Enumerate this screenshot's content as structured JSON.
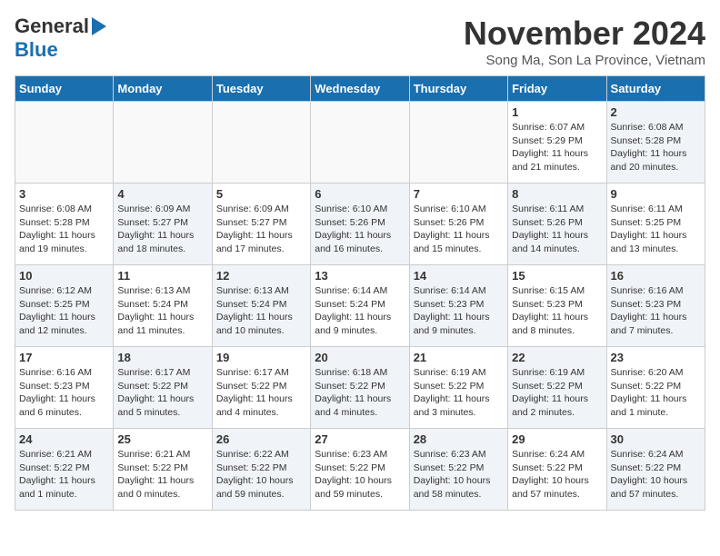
{
  "header": {
    "logo_line1": "General",
    "logo_line2": "Blue",
    "title": "November 2024",
    "location": "Song Ma, Son La Province, Vietnam"
  },
  "weekdays": [
    "Sunday",
    "Monday",
    "Tuesday",
    "Wednesday",
    "Thursday",
    "Friday",
    "Saturday"
  ],
  "weeks": [
    [
      {
        "day": "",
        "info": ""
      },
      {
        "day": "",
        "info": ""
      },
      {
        "day": "",
        "info": ""
      },
      {
        "day": "",
        "info": ""
      },
      {
        "day": "",
        "info": ""
      },
      {
        "day": "1",
        "info": "Sunrise: 6:07 AM\nSunset: 5:29 PM\nDaylight: 11 hours and 21 minutes."
      },
      {
        "day": "2",
        "info": "Sunrise: 6:08 AM\nSunset: 5:28 PM\nDaylight: 11 hours and 20 minutes."
      }
    ],
    [
      {
        "day": "3",
        "info": "Sunrise: 6:08 AM\nSunset: 5:28 PM\nDaylight: 11 hours and 19 minutes."
      },
      {
        "day": "4",
        "info": "Sunrise: 6:09 AM\nSunset: 5:27 PM\nDaylight: 11 hours and 18 minutes."
      },
      {
        "day": "5",
        "info": "Sunrise: 6:09 AM\nSunset: 5:27 PM\nDaylight: 11 hours and 17 minutes."
      },
      {
        "day": "6",
        "info": "Sunrise: 6:10 AM\nSunset: 5:26 PM\nDaylight: 11 hours and 16 minutes."
      },
      {
        "day": "7",
        "info": "Sunrise: 6:10 AM\nSunset: 5:26 PM\nDaylight: 11 hours and 15 minutes."
      },
      {
        "day": "8",
        "info": "Sunrise: 6:11 AM\nSunset: 5:26 PM\nDaylight: 11 hours and 14 minutes."
      },
      {
        "day": "9",
        "info": "Sunrise: 6:11 AM\nSunset: 5:25 PM\nDaylight: 11 hours and 13 minutes."
      }
    ],
    [
      {
        "day": "10",
        "info": "Sunrise: 6:12 AM\nSunset: 5:25 PM\nDaylight: 11 hours and 12 minutes."
      },
      {
        "day": "11",
        "info": "Sunrise: 6:13 AM\nSunset: 5:24 PM\nDaylight: 11 hours and 11 minutes."
      },
      {
        "day": "12",
        "info": "Sunrise: 6:13 AM\nSunset: 5:24 PM\nDaylight: 11 hours and 10 minutes."
      },
      {
        "day": "13",
        "info": "Sunrise: 6:14 AM\nSunset: 5:24 PM\nDaylight: 11 hours and 9 minutes."
      },
      {
        "day": "14",
        "info": "Sunrise: 6:14 AM\nSunset: 5:23 PM\nDaylight: 11 hours and 9 minutes."
      },
      {
        "day": "15",
        "info": "Sunrise: 6:15 AM\nSunset: 5:23 PM\nDaylight: 11 hours and 8 minutes."
      },
      {
        "day": "16",
        "info": "Sunrise: 6:16 AM\nSunset: 5:23 PM\nDaylight: 11 hours and 7 minutes."
      }
    ],
    [
      {
        "day": "17",
        "info": "Sunrise: 6:16 AM\nSunset: 5:23 PM\nDaylight: 11 hours and 6 minutes."
      },
      {
        "day": "18",
        "info": "Sunrise: 6:17 AM\nSunset: 5:22 PM\nDaylight: 11 hours and 5 minutes."
      },
      {
        "day": "19",
        "info": "Sunrise: 6:17 AM\nSunset: 5:22 PM\nDaylight: 11 hours and 4 minutes."
      },
      {
        "day": "20",
        "info": "Sunrise: 6:18 AM\nSunset: 5:22 PM\nDaylight: 11 hours and 4 minutes."
      },
      {
        "day": "21",
        "info": "Sunrise: 6:19 AM\nSunset: 5:22 PM\nDaylight: 11 hours and 3 minutes."
      },
      {
        "day": "22",
        "info": "Sunrise: 6:19 AM\nSunset: 5:22 PM\nDaylight: 11 hours and 2 minutes."
      },
      {
        "day": "23",
        "info": "Sunrise: 6:20 AM\nSunset: 5:22 PM\nDaylight: 11 hours and 1 minute."
      }
    ],
    [
      {
        "day": "24",
        "info": "Sunrise: 6:21 AM\nSunset: 5:22 PM\nDaylight: 11 hours and 1 minute."
      },
      {
        "day": "25",
        "info": "Sunrise: 6:21 AM\nSunset: 5:22 PM\nDaylight: 11 hours and 0 minutes."
      },
      {
        "day": "26",
        "info": "Sunrise: 6:22 AM\nSunset: 5:22 PM\nDaylight: 10 hours and 59 minutes."
      },
      {
        "day": "27",
        "info": "Sunrise: 6:23 AM\nSunset: 5:22 PM\nDaylight: 10 hours and 59 minutes."
      },
      {
        "day": "28",
        "info": "Sunrise: 6:23 AM\nSunset: 5:22 PM\nDaylight: 10 hours and 58 minutes."
      },
      {
        "day": "29",
        "info": "Sunrise: 6:24 AM\nSunset: 5:22 PM\nDaylight: 10 hours and 57 minutes."
      },
      {
        "day": "30",
        "info": "Sunrise: 6:24 AM\nSunset: 5:22 PM\nDaylight: 10 hours and 57 minutes."
      }
    ]
  ]
}
